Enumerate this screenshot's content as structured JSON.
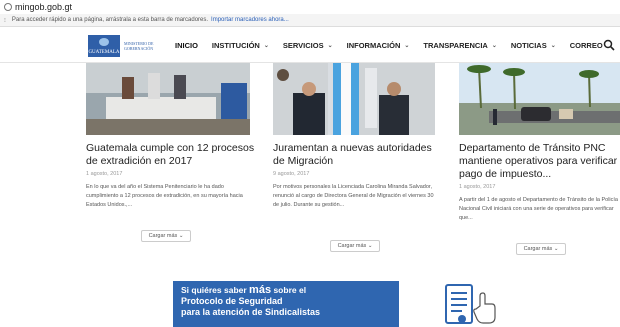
{
  "browser": {
    "url": "mingob.gob.gt",
    "bookmarks_text": "Para acceder rápido a una página, arrástrala a esta barra de marcadores.",
    "import_link": "Importar marcadores ahora..."
  },
  "logo": {
    "name": "GUATEMALA",
    "ministry": "MINISTERIO DE GOBERNACIÓN"
  },
  "nav": {
    "items": [
      {
        "label": "INICIO"
      },
      {
        "label": "INSTITUCIÓN"
      },
      {
        "label": "SERVICIOS"
      },
      {
        "label": "INFORMACIÓN"
      },
      {
        "label": "TRANSPARENCIA"
      },
      {
        "label": "NOTICIAS"
      },
      {
        "label": "CORREO"
      }
    ]
  },
  "articles": [
    {
      "title": "Guatemala cumple con 12 procesos de extradición en 2017",
      "date": "1 agosto, 2017",
      "excerpt": "En lo que va del año el Sistema Penitenciario le ha dado cumplimiento a 12 procesos de extradición, en su mayoría hacia Estados Unidos.,...",
      "more": "Cargar más"
    },
    {
      "title": "Juramentan a nuevas autoridades de Migración",
      "date": "9 agosto, 2017",
      "excerpt": "Por motivos personales la Licenciada Carolina Miranda Salvador, renunció al cargo de Directora General de Migración el viernes 30 de julio. Durante su gestión...",
      "more": "Cargar más"
    },
    {
      "title": "Departamento de Tránsito PNC mantiene operativos para verificar pago de impuesto...",
      "date": "1 agosto, 2017",
      "excerpt": "A partir del 1 de agosto el Departamento de Tránsito de la Policía Nacional Civil iniciará con una serie de operativos para verificar que...",
      "more": "Cargar más"
    }
  ],
  "banner": {
    "line1_prefix": "Si quiéres saber",
    "line1_emphasis": "más",
    "line1_suffix": "sobre el",
    "line2": "Protocolo de Seguridad",
    "line3": "para la atención de Sindicalistas"
  },
  "colors": {
    "accent": "#2f66b0",
    "nav_text": "#222222",
    "link": "#2b60b8"
  }
}
